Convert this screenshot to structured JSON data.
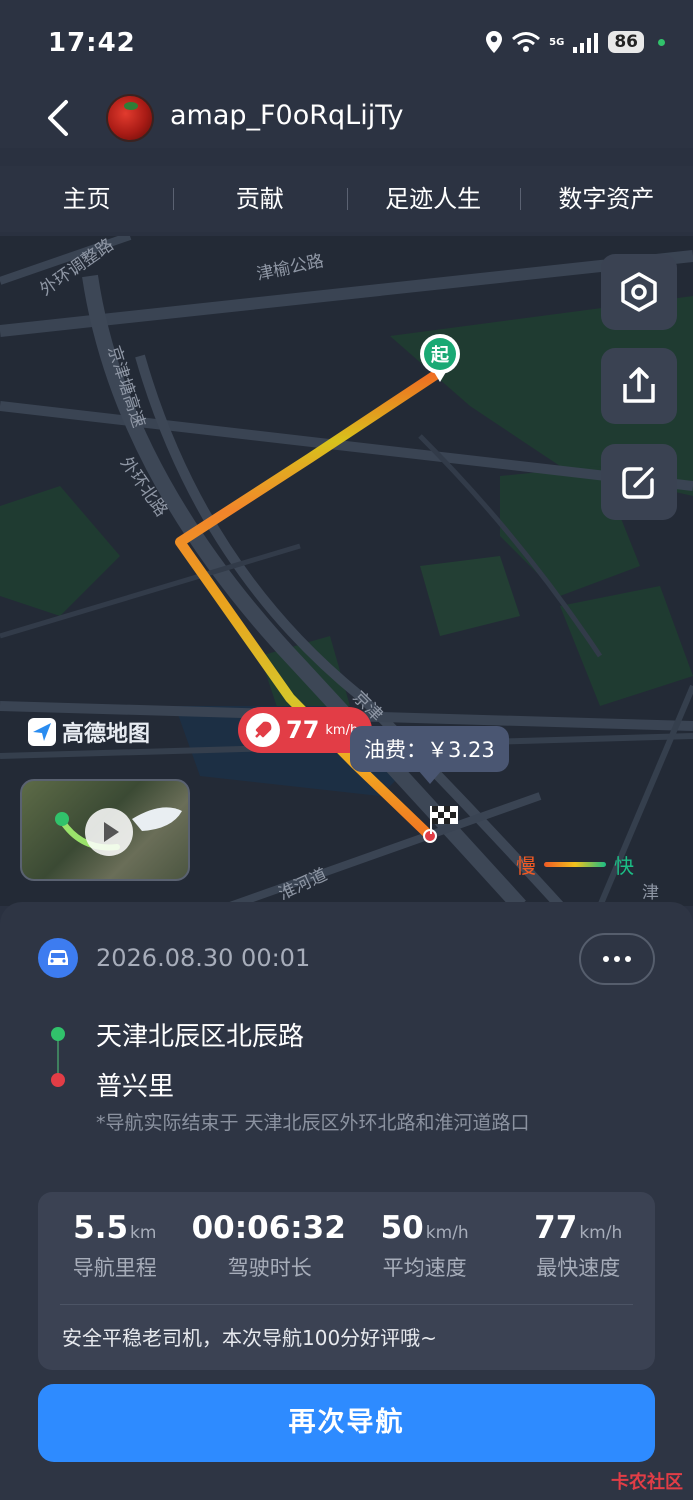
{
  "status_bar": {
    "time": "17:42",
    "battery": "86",
    "network": "5G"
  },
  "header": {
    "username": "amap_F0oRqLijTy"
  },
  "tabs": [
    {
      "label": "主页"
    },
    {
      "label": "贡献"
    },
    {
      "label": "足迹人生"
    },
    {
      "label": "数字资产"
    }
  ],
  "map": {
    "road_labels": [
      "外环调整路",
      "津榆公路",
      "京津塘高速",
      "外环北路",
      "京津",
      "淮河道",
      "津"
    ],
    "start_marker": "起",
    "logo_text": "高德地图",
    "speed_bubble": {
      "value": "77",
      "unit": "km/h"
    },
    "fuel_bubble": "油费：￥3.23",
    "legend": {
      "slow": "慢",
      "fast": "快"
    },
    "icons": [
      "settings-hexagon-icon",
      "share-icon",
      "edit-icon",
      "play-icon",
      "rocket-icon",
      "finish-flag-icon"
    ]
  },
  "trip": {
    "date": "2026.08.30 00:01",
    "origin": "天津北辰区北辰路",
    "destination": "普兴里",
    "note": "*导航实际结束于 天津北辰区外环北路和淮河道路口"
  },
  "stats": [
    {
      "value": "5.5",
      "unit": "km",
      "label": "导航里程"
    },
    {
      "value": "00:06:32",
      "unit": "",
      "label": "驾驶时长"
    },
    {
      "value": "50",
      "unit": "km/h",
      "label": "平均速度"
    },
    {
      "value": "77",
      "unit": "km/h",
      "label": "最快速度"
    }
  ],
  "comment": "安全平稳老司机，本次导航100分好评哦~",
  "navigate_again": "再次导航",
  "watermark": "卡农社区",
  "colors": {
    "accent": "#2e8bff",
    "route_slow": "#f05a24",
    "route_mid": "#f2c21d",
    "route_fast": "#1bbd85",
    "start": "#1aa974",
    "end": "#e23d46"
  }
}
